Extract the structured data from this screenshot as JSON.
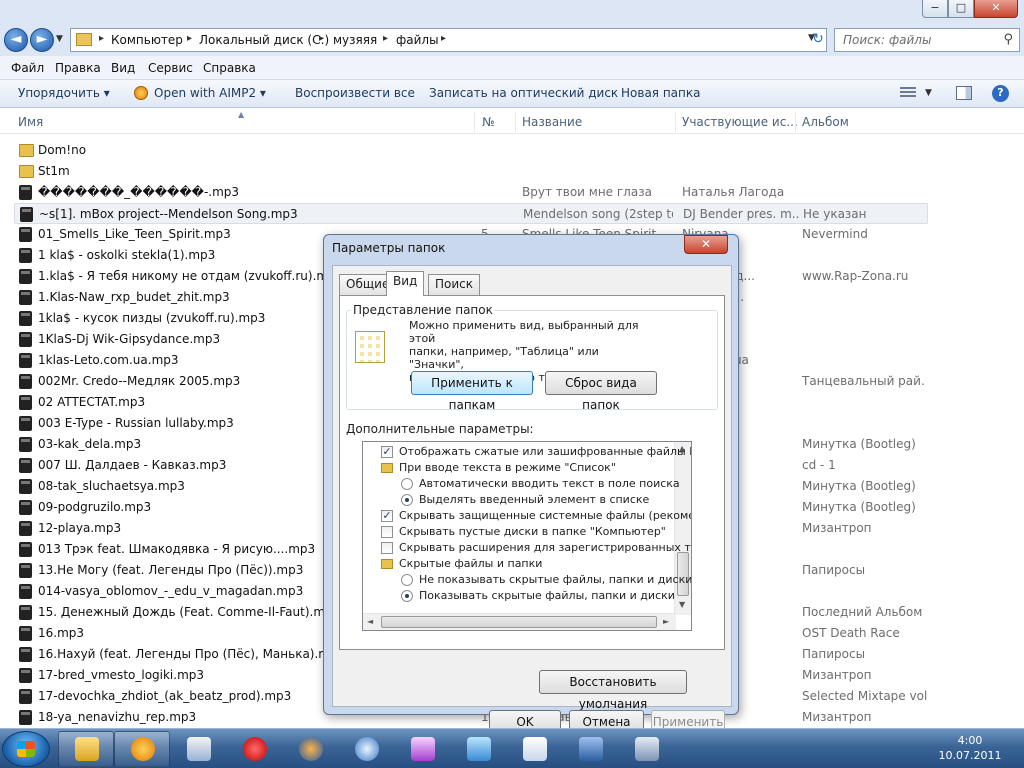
{
  "window": {
    "min_label": "−",
    "max_label": "□",
    "close_label": "✕"
  },
  "nav": {
    "back_label": "◄",
    "fwd_label": "►",
    "drop": "▼",
    "refresh": "↻",
    "crumbs": [
      "Компьютер",
      "Локальный диск (C:)",
      "музяяя",
      "файлы"
    ],
    "search_placeholder": "Поиск: файлы"
  },
  "menu": [
    "Файл",
    "Правка",
    "Вид",
    "Сервис",
    "Справка"
  ],
  "commands": {
    "organize": "Упорядочить ▾",
    "aimp": "Open with AIMP2 ▾",
    "play_all": "Воспроизвести все",
    "burn": "Записать на оптический диск",
    "new_folder": "Новая папка",
    "help": "?"
  },
  "columns": {
    "name": "Имя",
    "num": "№",
    "title": "Название",
    "artists": "Участвующие ис...",
    "album": "Альбом"
  },
  "files": [
    {
      "type": "folder",
      "name": "Dom!no",
      "num": "",
      "title": "",
      "artist": "",
      "album": ""
    },
    {
      "type": "folder",
      "name": "St1m",
      "num": "",
      "title": "",
      "artist": "",
      "album": ""
    },
    {
      "type": "audio",
      "name": "�������_������-.mp3",
      "num": "",
      "title": "Врут твои мне глаза",
      "artist": "Наталья Лагода",
      "album": ""
    },
    {
      "type": "audio",
      "name": "~s[1]. mBox project--Mendelson Song.mp3",
      "num": "",
      "title": "Mendelson song (2step to...",
      "artist": "DJ Bender pres. m...",
      "album": "Не указан"
    },
    {
      "type": "audio",
      "name": "01_Smells_Like_Teen_Spirit.mp3",
      "num": "5",
      "title": "Smells Like Teen Spirit",
      "artist": "Nirvana",
      "album": "Nevermind"
    },
    {
      "type": "audio",
      "name": "1 kla$ - oskolki stekla(1).mp3",
      "num": "",
      "title": "",
      "artist": "",
      "album": ""
    },
    {
      "type": "audio",
      "name": "1.kla$ - Я тебя никому не отдам (zvukoff.ru).mp3",
      "num": "",
      "title": "",
      "artist": "...й народ...",
      "album": "www.Rap-Zona.ru"
    },
    {
      "type": "audio",
      "name": "1.Klas-Naw_rxp_budet_zhit.mp3",
      "num": "",
      "title": "",
      "artist": "kla$_-_N...",
      "album": ""
    },
    {
      "type": "audio",
      "name": "1kla$ - кусок пизды (zvukoff.ru).mp3",
      "num": "",
      "title": "",
      "artist": "",
      "album": ""
    },
    {
      "type": "audio",
      "name": "1KlaS-Dj Wik-Gipsydance.mp3",
      "num": "",
      "title": "",
      "artist": "Wik Gip...",
      "album": ""
    },
    {
      "type": "audio",
      "name": "1klas-Leto.com.ua.mp3",
      "num": "",
      "title": "",
      "artist": "ect.com.ua",
      "album": ""
    },
    {
      "type": "audio",
      "name": "002Mr. Credo--Медляк 2005.mp3",
      "num": "",
      "title": "",
      "artist": "",
      "album": "Танцевальный рай. ..."
    },
    {
      "type": "audio",
      "name": "02 ATTECTAT.mp3",
      "num": "",
      "title": "",
      "artist": "",
      "album": ""
    },
    {
      "type": "audio",
      "name": "003 E-Type - Russian lullaby.mp3",
      "num": "",
      "title": "",
      "artist": "",
      "album": ""
    },
    {
      "type": "audio",
      "name": "03-kak_dela.mp3",
      "num": "",
      "title": "",
      "artist": "",
      "album": "Минутка (Bootleg)"
    },
    {
      "type": "audio",
      "name": "007 Ш. Далдаев - Кавказ.mp3",
      "num": "",
      "title": "",
      "artist": "...Й ХИТ",
      "album": "cd - 1"
    },
    {
      "type": "audio",
      "name": "08-tak_sluchaetsya.mp3",
      "num": "",
      "title": "",
      "artist": "",
      "album": "Минутка (Bootleg)"
    },
    {
      "type": "audio",
      "name": "09-podgruzilo.mp3",
      "num": "",
      "title": "",
      "artist": "",
      "album": "Минутка (Bootleg)"
    },
    {
      "type": "audio",
      "name": "12-playa.mp3",
      "num": "",
      "title": "",
      "artist": "",
      "album": "Мизантроп"
    },
    {
      "type": "audio",
      "name": "013 Трэк feat. Шмакодявка - Я рисую....mp3",
      "num": "",
      "title": "",
      "artist": "",
      "album": ""
    },
    {
      "type": "audio",
      "name": "13.Не Могу (feat. Легенды Про (Пёс)).mp3",
      "num": "",
      "title": "",
      "artist": "",
      "album": "Папиросы"
    },
    {
      "type": "audio",
      "name": "014-vasya_oblomov_-_edu_v_magadan.mp3",
      "num": "",
      "title": "",
      "artist": "...мов",
      "album": ""
    },
    {
      "type": "audio",
      "name": "15. Денежный Дождь (Feat. Comme-Il-Faut).mp3",
      "num": "",
      "title": "",
      "artist": "",
      "album": "Последний Альбом"
    },
    {
      "type": "audio",
      "name": "16.mp3",
      "num": "",
      "title": "",
      "artist": "...ager",
      "album": "OST Death Race"
    },
    {
      "type": "audio",
      "name": "16.Нахуй (feat. Легенды Про (Пёс), Манька).mp3",
      "num": "",
      "title": "",
      "artist": "",
      "album": "Папиросы"
    },
    {
      "type": "audio",
      "name": "17-bred_vmesto_logiki.mp3",
      "num": "",
      "title": "",
      "artist": "",
      "album": "Мизантроп"
    },
    {
      "type": "audio",
      "name": "17-devochka_zhdiot_(ak_beatz_prod).mp3",
      "num": "",
      "title": "",
      "artist": "",
      "album": "Selected Mixtape vol.1"
    },
    {
      "type": "audio",
      "name": "18-ya_nenavizhu_rep.mp3",
      "num": "18",
      "title": "Я ненавижу рэп",
      "artist": "Dessar",
      "album": "Мизантроп"
    }
  ],
  "dialog": {
    "title": "Параметры папок",
    "close": "✕",
    "tabs": [
      "Общие",
      "Вид",
      "Поиск"
    ],
    "group_label": "Представление папок",
    "group_text": "Можно применить вид, выбранный для этой\nпапки, например, \"Таблица\" или \"Значки\",\nко всем папкам этого типа.",
    "apply_to_folders": "Применить к папкам",
    "reset_folders": "Сброс вида папок",
    "advanced_label": "Дополнительные параметры:",
    "tree": [
      {
        "kind": "check",
        "checked": true,
        "indent": 0,
        "label": "Отображать сжатые или зашифрованные файлы NTFS"
      },
      {
        "kind": "folder",
        "indent": 0,
        "label": "При вводе текста в режиме \"Список\""
      },
      {
        "kind": "radio",
        "checked": false,
        "indent": 1,
        "label": "Автоматически вводить текст в поле поиска"
      },
      {
        "kind": "radio",
        "checked": true,
        "indent": 1,
        "label": "Выделять введенный элемент в списке"
      },
      {
        "kind": "check",
        "checked": true,
        "indent": 0,
        "label": "Скрывать защищенные системные файлы (рекомендуется)"
      },
      {
        "kind": "check",
        "checked": false,
        "indent": 0,
        "label": "Скрывать пустые диски в папке \"Компьютер\""
      },
      {
        "kind": "check",
        "checked": false,
        "indent": 0,
        "label": "Скрывать расширения для зарегистрированных типов"
      },
      {
        "kind": "folder",
        "indent": 0,
        "label": "Скрытые файлы и папки"
      },
      {
        "kind": "radio",
        "checked": false,
        "indent": 1,
        "label": "Не показывать скрытые файлы, папки и диски"
      },
      {
        "kind": "radio",
        "checked": true,
        "indent": 1,
        "label": "Показывать скрытые файлы, папки и диски"
      }
    ],
    "restore": "Восстановить умолчания",
    "ok": "OK",
    "cancel": "Отмена",
    "apply": "Применить"
  },
  "taskbar": {
    "apps": [
      "explorer",
      "aimp",
      "media-player",
      "opera",
      "firefox",
      "network",
      "winrar",
      "messenger",
      "notepad",
      "virtualbox",
      "calculator"
    ],
    "time": "4:00",
    "date": "10.07.2011"
  }
}
